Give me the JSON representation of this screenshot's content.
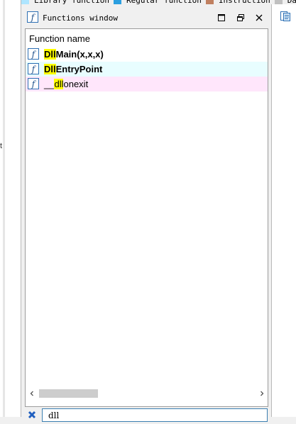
{
  "legend": {
    "items": [
      {
        "label": "Library function",
        "color": "#aee5ff"
      },
      {
        "label": "Regular function",
        "color": "#2b9fe0"
      },
      {
        "label": "Instruction",
        "color": "#c08060"
      },
      {
        "label": "Data",
        "color": "#c0c0c0"
      }
    ]
  },
  "left_strip": {
    "mark": "t"
  },
  "functions_window": {
    "title": "Functions window",
    "icon": "function-f-icon",
    "title_buttons": [
      "maximize-icon",
      "restore-icon",
      "close-icon"
    ],
    "column_header": "Function name",
    "rows": [
      {
        "match": "Dll",
        "rest": "Main(x,x,x)",
        "prefix": "",
        "bold": true,
        "bg": "#ffffff",
        "icon": "function-f-icon"
      },
      {
        "match": "Dll",
        "rest": "EntryPoint",
        "prefix": "",
        "bold": true,
        "bg": "#e8fdff",
        "icon": "function-f-icon"
      },
      {
        "prefix": "__",
        "match": "dll",
        "rest": "onexit",
        "bold": false,
        "bg": "#ffe6fb",
        "icon": "function-f-icon"
      }
    ],
    "highlight_color": "#ffff00",
    "scrollbar": {
      "left_icon": "scroll-left-icon",
      "right_icon": "scroll-right-icon"
    },
    "filter": {
      "value": "dll",
      "clear_icon": "clear-filter-icon"
    }
  },
  "right_panel": {
    "button_icon": "document-icon"
  }
}
